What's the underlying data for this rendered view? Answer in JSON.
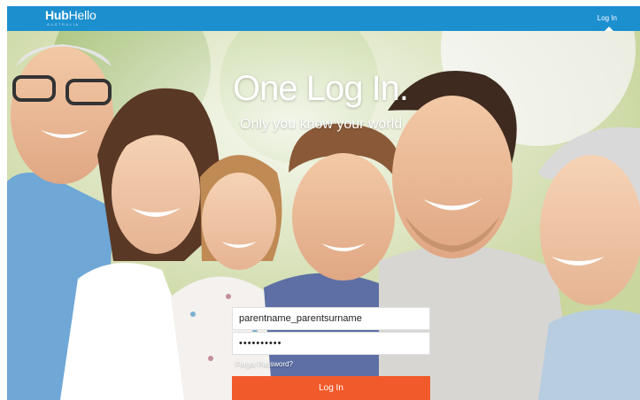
{
  "header": {
    "logo_main_bold": "Hub",
    "logo_main_light": "Hello",
    "logo_sub": "AUSTRALIA",
    "login_link": "Log In"
  },
  "hero": {
    "headline": "One Log In.",
    "subhead": "Only you know your world",
    "image": "family-photo"
  },
  "login": {
    "username_value": "parentname_parentsurname",
    "password_value": "••••••••••",
    "forgot_label": "Forgot Password?",
    "submit_label": "Log In"
  },
  "colors": {
    "navbar": "#1c8fcf",
    "button": "#f15a2b"
  }
}
